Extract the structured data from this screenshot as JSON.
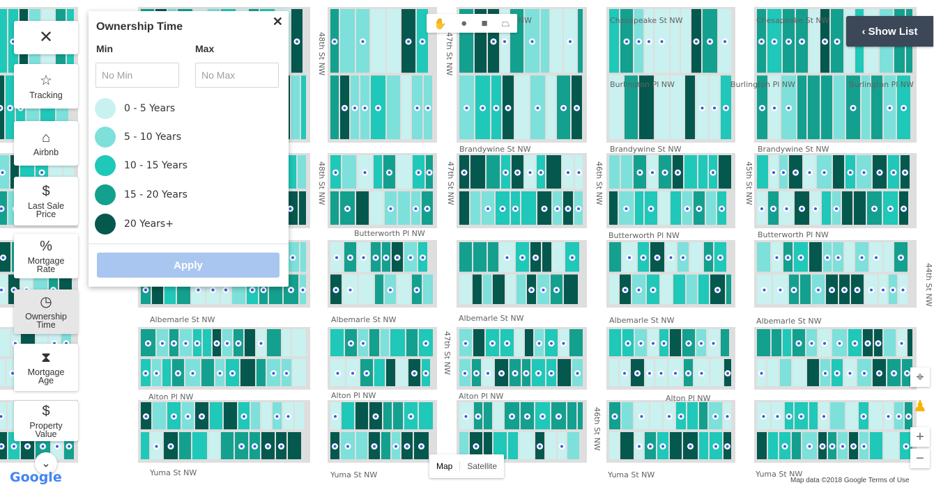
{
  "streets": {
    "h": [
      {
        "label": "Chesapeake St NW"
      },
      {
        "label": "Chesapeake St NW"
      },
      {
        "label": "Burlington Pl NW"
      },
      {
        "label": "Burlington Pl NW"
      },
      {
        "label": "Burlington Pl NW"
      },
      {
        "label": "Brandywine St NW"
      },
      {
        "label": "Brandywine St NW"
      },
      {
        "label": "Brandywine St NW"
      },
      {
        "label": "Butterworth Pl NW"
      },
      {
        "label": "Butterworth Pl NW"
      },
      {
        "label": "Butterworth Pl NW"
      },
      {
        "label": "Albemarle St NW"
      },
      {
        "label": "Albemarle St NW"
      },
      {
        "label": "Albemarle St NW"
      },
      {
        "label": "Albemarle St NW"
      },
      {
        "label": "Albemarle St NW"
      },
      {
        "label": "Alton Pl NW"
      },
      {
        "label": "Alton Pl NW"
      },
      {
        "label": "Alton Pl NW"
      },
      {
        "label": "Alton Pl NW"
      },
      {
        "label": "Yuma St NW"
      },
      {
        "label": "Yuma St NW"
      },
      {
        "label": "Yuma St NW"
      },
      {
        "label": "Yuma St NW"
      },
      {
        "label": "t NW"
      }
    ],
    "v": [
      {
        "label": "48th St NW"
      },
      {
        "label": "47th St NW"
      },
      {
        "label": "48th St NW"
      },
      {
        "label": "47th St NW"
      },
      {
        "label": "46th St NW"
      },
      {
        "label": "45th St NW"
      },
      {
        "label": "47th St NW"
      },
      {
        "label": "46th St NW"
      },
      {
        "label": "44th St NW"
      }
    ]
  },
  "sidebar": {
    "close_icon": "close-icon",
    "items": [
      {
        "label": "Tracking",
        "icon": "☆"
      },
      {
        "label": "Airbnb",
        "icon": "⌂"
      },
      {
        "label": "Last Sale Price",
        "icon": "$"
      },
      {
        "label": "Mortgage Rate",
        "icon": "%"
      },
      {
        "label": "Ownership Time",
        "icon": "◷"
      },
      {
        "label": "Mortgage Age",
        "icon": "⧗"
      },
      {
        "label": "Property Value",
        "icon": "$"
      }
    ]
  },
  "panel": {
    "title": "Ownership Time",
    "min_label": "Min",
    "max_label": "Max",
    "min_placeholder": "No Min",
    "max_placeholder": "No Max",
    "legend": [
      {
        "label": "0 - 5 Years",
        "color": "#c9f1ef"
      },
      {
        "label": "5 - 10 Years",
        "color": "#7de0da"
      },
      {
        "label": "10 - 15 Years",
        "color": "#1fc8b8"
      },
      {
        "label": "15 - 20 Years",
        "color": "#14a08f"
      },
      {
        "label": "20 Years+",
        "color": "#05584e"
      }
    ],
    "apply": "Apply"
  },
  "show_list": "‹ Show List",
  "maptype": {
    "map": "Map",
    "satellite": "Satellite"
  },
  "attribution": "Map data ©2018 Google   Terms of Use",
  "google": "Google",
  "colors": {
    "c0": "#c9f1ef",
    "c1": "#7de0da",
    "c2": "#1fc8b8",
    "c3": "#14a08f",
    "c4": "#05584e",
    "road": "#ffffff",
    "block": "#dedede"
  }
}
